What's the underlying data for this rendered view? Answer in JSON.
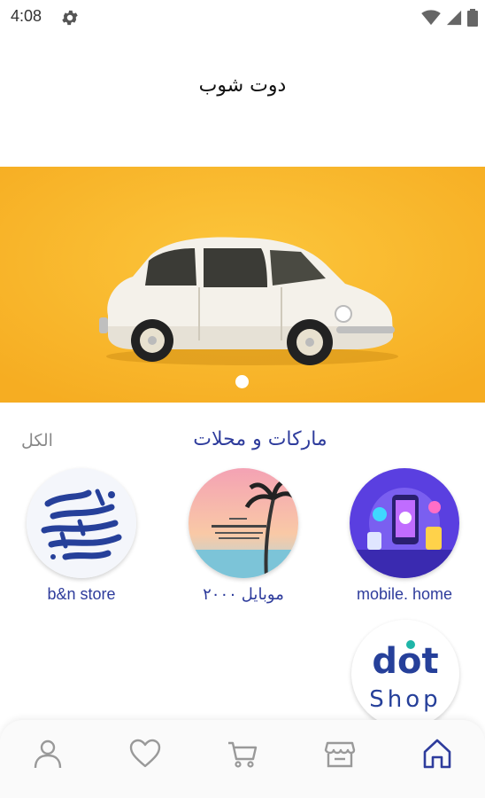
{
  "status_bar": {
    "time": "4:08",
    "icons": [
      "settings-icon",
      "wifi-icon",
      "signal-icon",
      "battery-icon"
    ]
  },
  "header": {
    "title": "دوت شوب"
  },
  "banner": {
    "image": "white-car-on-yellow-background",
    "slide_count": 1,
    "active_slide": 1
  },
  "section": {
    "title": "ماركات و محلات",
    "see_all": "الكل"
  },
  "stores": [
    {
      "name": "mobile. home",
      "image": "phones-and-gadgets-logo"
    },
    {
      "name": "موبايل ٢٠٠٠",
      "image": "sunset-palm-calligraphy-logo"
    },
    {
      "name": "b&n store",
      "image": "arabic-calligraphy-logo"
    }
  ],
  "brand_logo": {
    "line1": "dot",
    "line2": "Shop"
  },
  "bottom_nav": [
    {
      "name": "home",
      "icon": "home-icon",
      "active": true
    },
    {
      "name": "stores",
      "icon": "store-icon",
      "active": false
    },
    {
      "name": "cart",
      "icon": "cart-icon",
      "active": false
    },
    {
      "name": "favorites",
      "icon": "heart-icon",
      "active": false
    },
    {
      "name": "profile",
      "icon": "user-icon",
      "active": false
    }
  ],
  "colors": {
    "accent": "#2e3c9c",
    "banner": "#fbbd2e",
    "logo_teal": "#1fb5a8",
    "muted": "#888888"
  }
}
